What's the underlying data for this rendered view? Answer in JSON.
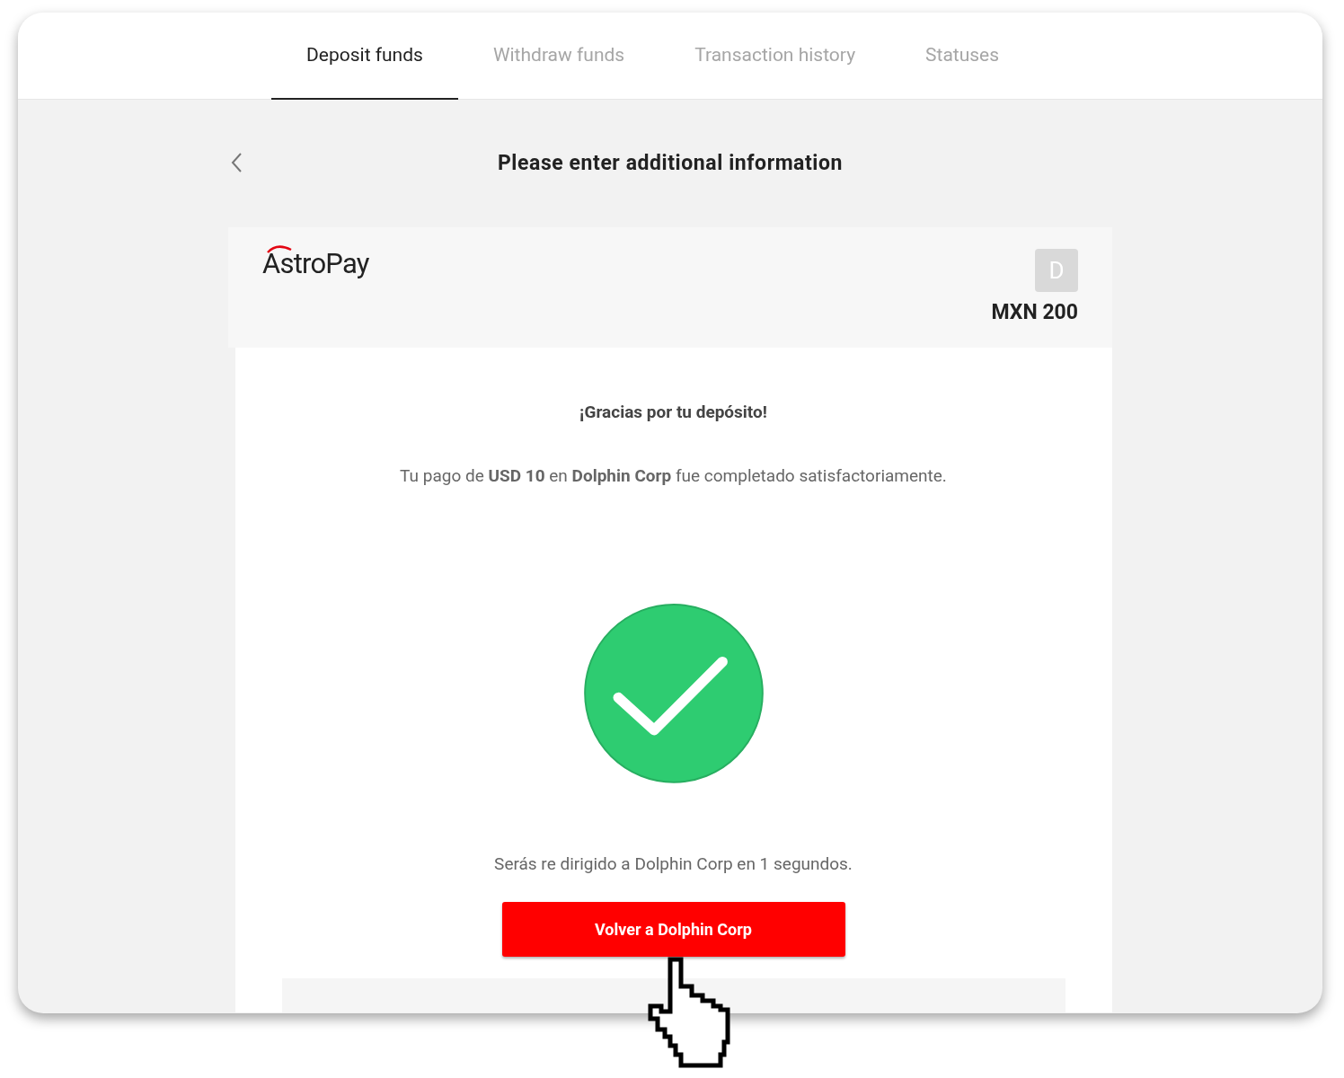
{
  "tabs": [
    {
      "label": "Deposit funds",
      "selected": true
    },
    {
      "label": "Withdraw funds",
      "selected": false
    },
    {
      "label": "Transaction history",
      "selected": false
    },
    {
      "label": "Statuses",
      "selected": false
    }
  ],
  "page_title": "Please enter additional information",
  "merchant": {
    "logo": "AstroPay",
    "avatar": "D",
    "amount": "MXN 200"
  },
  "confirmation": {
    "heading": "¡Gracias por tu depósito!",
    "message": "Tu pago de **USD 10** en **Dolphin Corp** fue completado satisfactoriamente.",
    "redirect_text": "Serás re dirigido a Dolphin Corp en 1 segundos.",
    "button": "Volver a Dolphin Corp"
  }
}
